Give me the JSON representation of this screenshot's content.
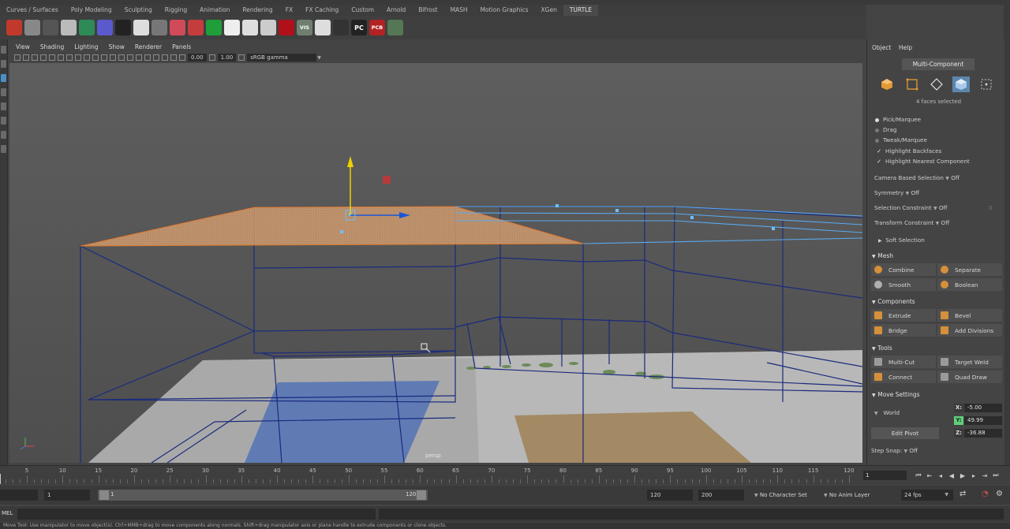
{
  "shelf_tabs": [
    "Curves / Surfaces",
    "Poly Modeling",
    "Sculpting",
    "Rigging",
    "Animation",
    "Rendering",
    "FX",
    "FX Caching",
    "Custom",
    "Arnold",
    "Bifrost",
    "MASH",
    "Motion Graphics",
    "XGen",
    "TURTLE"
  ],
  "shelf_active_tab": "TURTLE",
  "shelf_icons": [
    {
      "name": "fire-icon",
      "color": "#c0392b",
      "text": ""
    },
    {
      "name": "material-ball-icon",
      "color": "#888888",
      "text": ""
    },
    {
      "name": "sphere-dark-icon",
      "color": "#555555",
      "text": ""
    },
    {
      "name": "sphere-light-icon",
      "color": "#bbbbbb",
      "text": ""
    },
    {
      "name": "green-cube-icon",
      "color": "#2e8b57",
      "text": ""
    },
    {
      "name": "checker-icon",
      "color": "#5a5acd",
      "text": ""
    },
    {
      "name": "particles-icon",
      "color": "#222222",
      "text": ""
    },
    {
      "name": "bubbles-icon",
      "color": "#dddddd",
      "text": ""
    },
    {
      "name": "bulb-icon",
      "color": "#777777",
      "text": ""
    },
    {
      "name": "render-red-icon",
      "color": "#d04a5a",
      "text": ""
    },
    {
      "name": "render-red2-icon",
      "color": "#c43c3c",
      "text": ""
    },
    {
      "name": "green-ball-icon",
      "color": "#1f9e3a",
      "text": ""
    },
    {
      "name": "clouds-icon",
      "color": "#eeeeee",
      "text": ""
    },
    {
      "name": "half-sphere-icon",
      "color": "#dddddd",
      "text": ""
    },
    {
      "name": "lips-icon",
      "color": "#cccccc",
      "text": ""
    },
    {
      "name": "play-red-icon",
      "color": "#b0101a",
      "text": ""
    },
    {
      "name": "vis-icon",
      "color": "#6f7f6f",
      "text": "VIS"
    },
    {
      "name": "no-render-icon",
      "color": "#dddddd",
      "text": ""
    },
    {
      "name": "page-icon",
      "color": "#333333",
      "text": ""
    },
    {
      "name": "pc-icon",
      "color": "#222222",
      "text": "PC"
    },
    {
      "name": "pcb-icon",
      "color": "#b22222",
      "text": "PCB"
    },
    {
      "name": "kill-icon",
      "color": "#557755",
      "text": ""
    }
  ],
  "viewport": {
    "menus": [
      "View",
      "Shading",
      "Lighting",
      "Show",
      "Renderer",
      "Panels"
    ],
    "exposure": "0.00",
    "gamma": "1.00",
    "color_space": "sRGB gamma",
    "camera_label": "persp"
  },
  "timeline": {
    "ticks": [
      "5",
      "10",
      "15",
      "20",
      "25",
      "30",
      "35",
      "40",
      "45",
      "50",
      "55",
      "60",
      "65",
      "70",
      "75",
      "80",
      "85",
      "90",
      "95",
      "100",
      "105",
      "110",
      "115",
      "120"
    ],
    "current_frame": "1"
  },
  "range_bar": {
    "start": "1",
    "range_start": "1",
    "range_end": "120",
    "end": "120",
    "max": "200",
    "character_set": "No Character Set",
    "anim_layer": "No Anim Layer",
    "fps": "24 fps"
  },
  "cmdline": {
    "label": "MEL",
    "help": "Move Tool: Use manipulator to move object(s). Ctrl+MMB+drag to move components along normals. Shift+drag manipulator axis or plane handle to extrude components or clone objects."
  },
  "panel": {
    "menus": [
      "Object",
      "Help"
    ],
    "mode_button": "Multi-Component",
    "selection_info": "4 faces selected",
    "pick_options": [
      "Pick/Marquee",
      "Drag",
      "Tweak/Marquee"
    ],
    "checks": [
      "Highlight Backfaces",
      "Highlight Nearest Component"
    ],
    "camera_based_selection": {
      "label": "Camera Based Selection",
      "value": "Off"
    },
    "symmetry": {
      "label": "Symmetry",
      "value": "Off"
    },
    "selection_constraint": {
      "label": "Selection Constraint",
      "value": "Off",
      "extra": "0"
    },
    "transform_constraint": {
      "label": "Transform Constraint",
      "value": "Off"
    },
    "soft_selection": "Soft Selection",
    "sections": {
      "mesh": {
        "title": "Mesh",
        "buttons": [
          "Combine",
          "Separate",
          "Smooth",
          "Boolean"
        ]
      },
      "components": {
        "title": "Components",
        "buttons": [
          "Extrude",
          "Bevel",
          "Bridge",
          "Add Divisions"
        ]
      },
      "tools": {
        "title": "Tools",
        "buttons": [
          "Multi-Cut",
          "Target Weld",
          "Connect",
          "Quad Draw"
        ]
      },
      "move_settings": {
        "title": "Move Settings",
        "space": "World",
        "edit_pivot": "Edit Pivot",
        "x": "-5.00",
        "y": "49.99",
        "z": "-36.88",
        "x_label": "X:",
        "y_label": "Y:",
        "z_label": "Z:"
      }
    },
    "step_snap": {
      "label": "Step Snap:",
      "value": "Off"
    }
  },
  "colors": {
    "selection_face": "#d29a6a",
    "wireframe": "#1a2a7a",
    "selected_wire": "#6fb3ff",
    "accent": "#5c86ad"
  }
}
